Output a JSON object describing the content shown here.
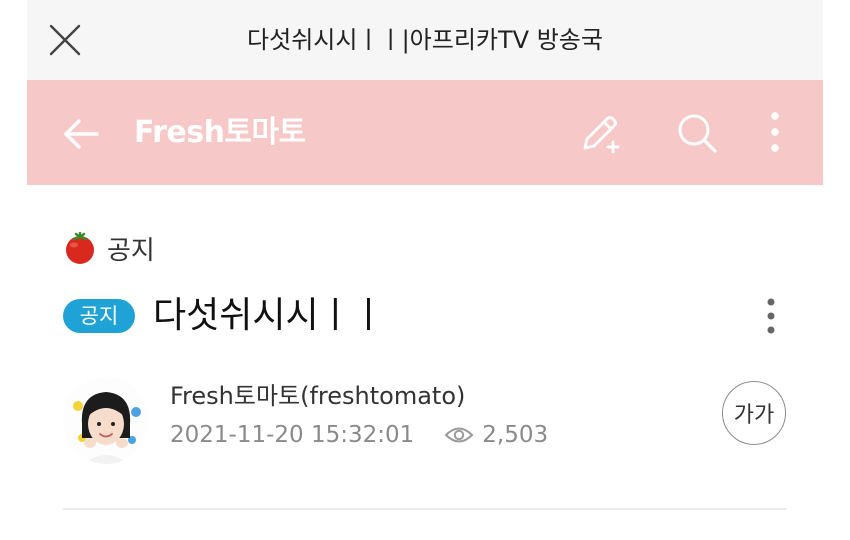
{
  "topbar": {
    "close_icon": "close-icon",
    "title": "다섯쉬시시ㅣㅣ|아프리카TV 방송국"
  },
  "header": {
    "back_icon": "arrow-left-icon",
    "station_name": "Fresh토마토",
    "write_icon": "pencil-plus-icon",
    "search_icon": "search-icon",
    "more_icon": "more-vertical-icon",
    "background_color": "#f7c8c8"
  },
  "category": {
    "icon": "tomato-icon",
    "label": "공지"
  },
  "post": {
    "badge": "공지",
    "badge_color": "#1fa3d6",
    "title": "다섯쉬시시ㅣㅣ",
    "more_icon": "more-vertical-icon"
  },
  "author": {
    "name": "Fresh토마토(freshtomato)",
    "datetime": "2021-11-20 15:32:01",
    "views": "2,503",
    "views_icon": "eye-icon"
  },
  "font_size_button": {
    "label": "가가"
  }
}
